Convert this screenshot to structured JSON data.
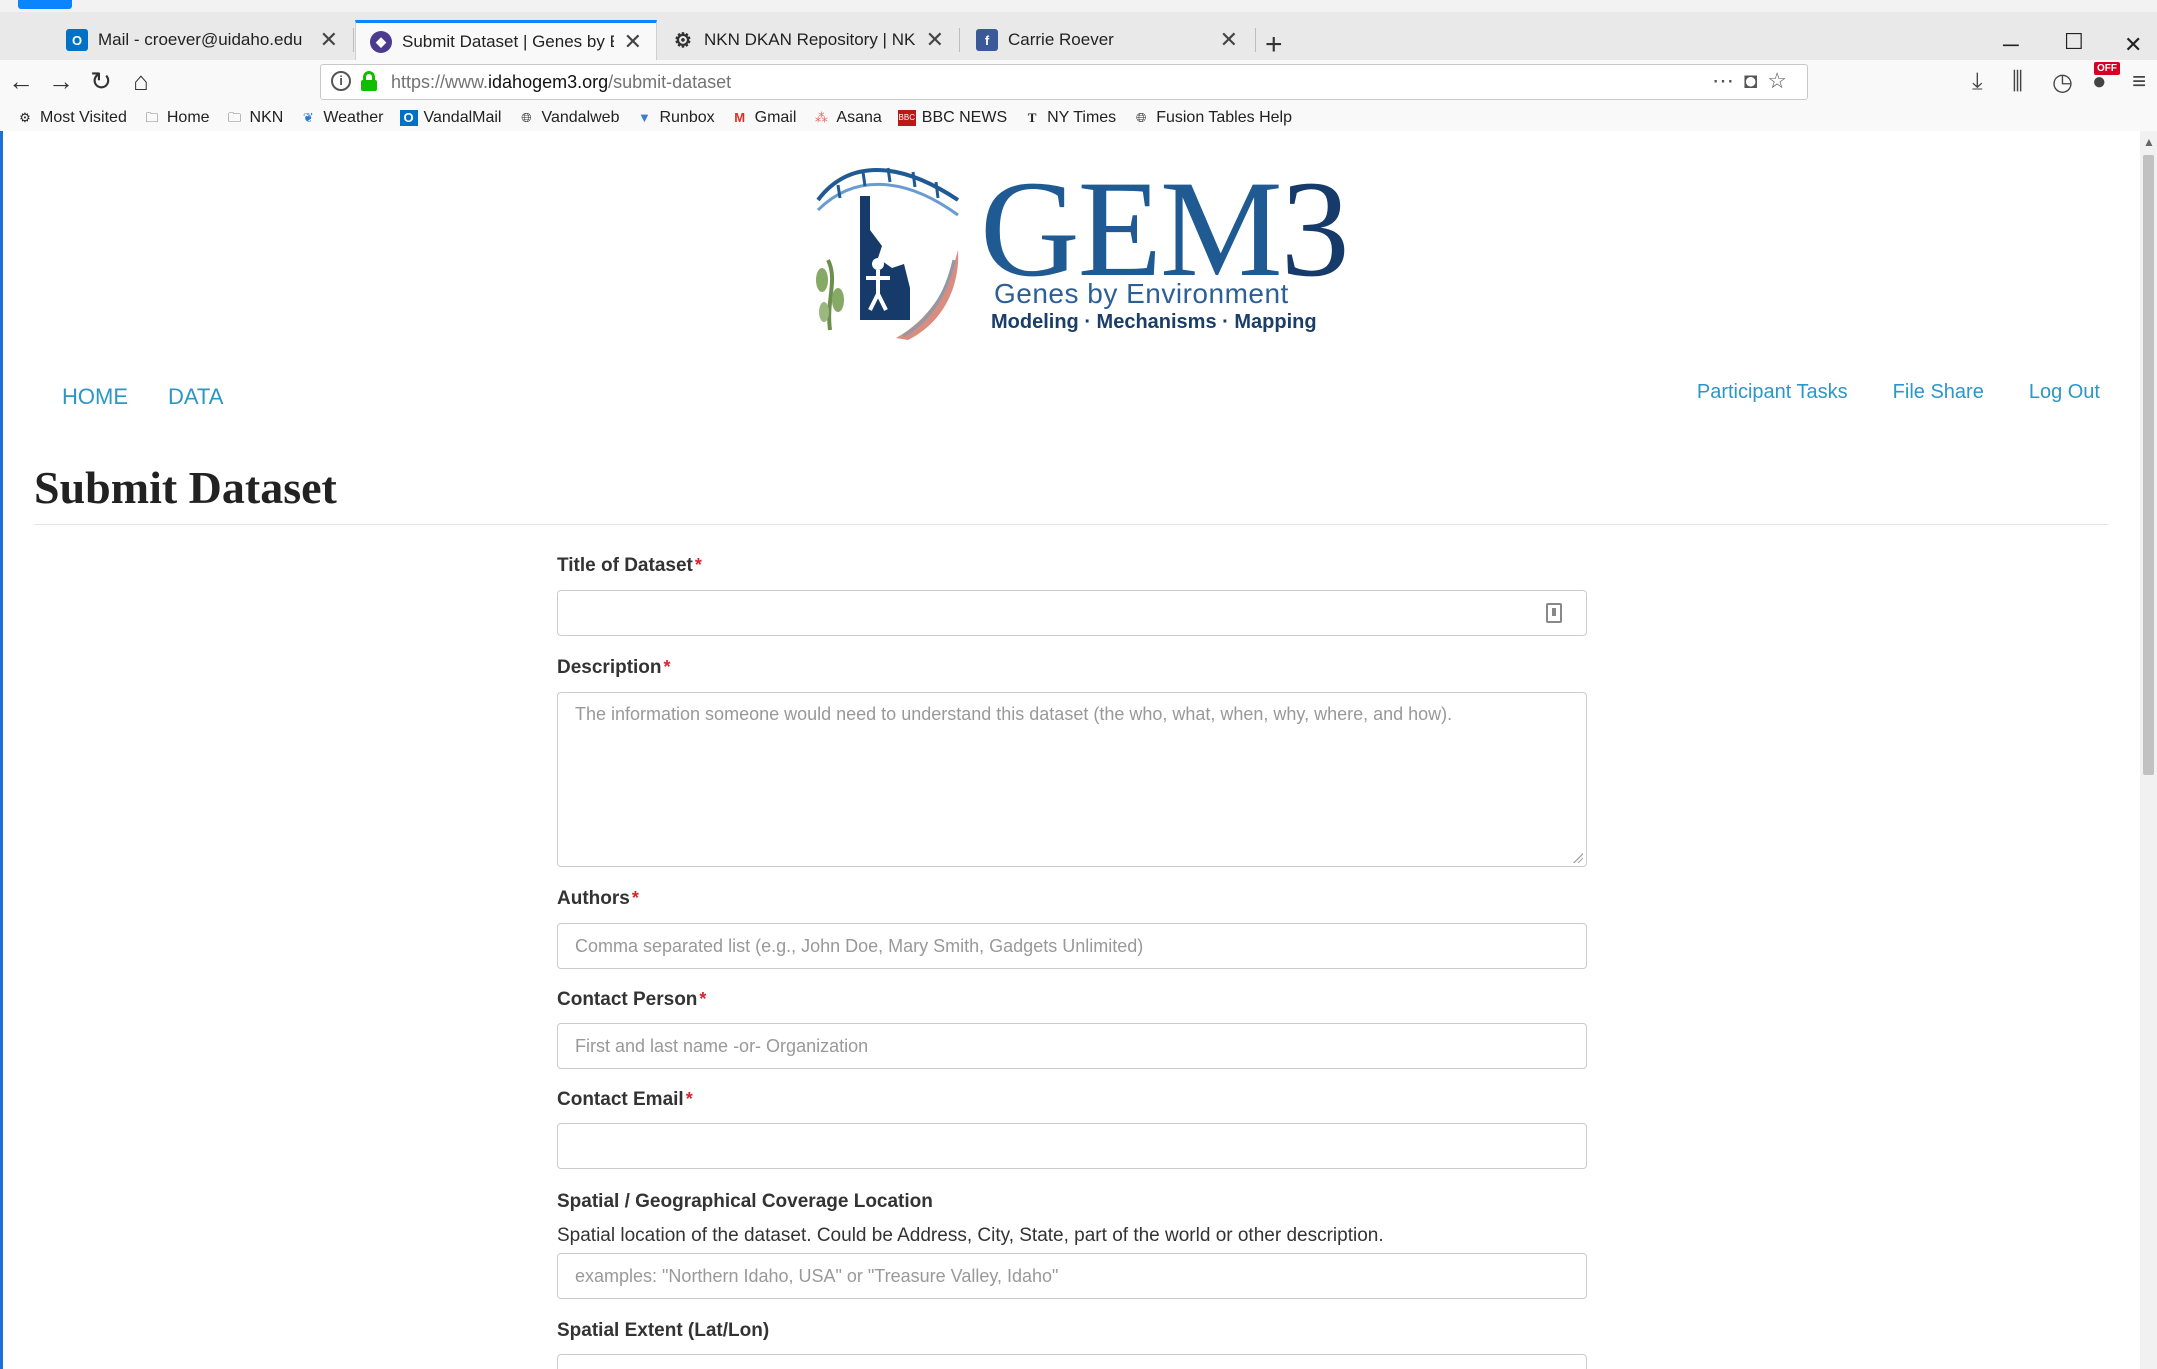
{
  "browser": {
    "tabs": [
      {
        "label": "Mail - croever@uidaho.edu",
        "icon": "outlook-icon",
        "active": false
      },
      {
        "label": "Submit Dataset | Genes by Envi",
        "icon": "gem3-icon",
        "active": true
      },
      {
        "label": "NKN DKAN Repository | NKN E",
        "icon": "dkan-icon",
        "active": false
      },
      {
        "label": "Carrie Roever",
        "icon": "facebook-icon",
        "active": false
      }
    ],
    "new_tab_symbol": "+",
    "url_prefix": "https://www.",
    "url_domain": "idahogem3.org",
    "url_path": "/submit-dataset",
    "bookmarks": [
      {
        "label": "Most Visited",
        "icon": "gear-icon"
      },
      {
        "label": "Home",
        "icon": "folder-icon"
      },
      {
        "label": "NKN",
        "icon": "folder-icon"
      },
      {
        "label": "Weather",
        "icon": "weather-icon"
      },
      {
        "label": "VandalMail",
        "icon": "outlook-icon"
      },
      {
        "label": "Vandalweb",
        "icon": "globe-icon"
      },
      {
        "label": "Runbox",
        "icon": "runbox-icon"
      },
      {
        "label": "Gmail",
        "icon": "gmail-icon"
      },
      {
        "label": "Asana",
        "icon": "asana-icon"
      },
      {
        "label": "BBC NEWS",
        "icon": "bbc-icon"
      },
      {
        "label": "NY Times",
        "icon": "nytimes-icon"
      },
      {
        "label": "Fusion Tables Help",
        "icon": "globe-icon"
      }
    ],
    "off_badge": "OFF"
  },
  "logo": {
    "title_main": "GEM",
    "title_num": "3",
    "subtitle": "Genes by Environment",
    "tagline": "Modeling · Mechanisms · Mapping"
  },
  "nav": {
    "home": "HOME",
    "data": "DATA",
    "participant_tasks": "Participant Tasks",
    "file_share": "File Share",
    "log_out": "Log Out"
  },
  "page_title": "Submit Dataset",
  "form": {
    "title_label": "Title of Dataset",
    "description_label": "Description",
    "description_placeholder": "The information someone would need to understand this dataset (the who, what, when, why, where, and how).",
    "authors_label": "Authors",
    "authors_placeholder": "Comma separated list (e.g.,  John Doe, Mary Smith, Gadgets Unlimited)",
    "contact_person_label": "Contact Person",
    "contact_person_placeholder": "First and last name -or- Organization",
    "contact_email_label": "Contact Email",
    "spatial_label": "Spatial / Geographical Coverage Location",
    "spatial_help": "Spatial location of the dataset. Could be Address, City, State, part of the world or other description.",
    "spatial_placeholder": "examples: \"Northern Idaho, USA\" or \"Treasure Valley, Idaho\"",
    "extent_label": "Spatial Extent (Lat/Lon)",
    "required_mark": "*"
  },
  "colors": {
    "link": "#2a97c7",
    "brand_blue": "#1f5a93",
    "required": "#d9232e",
    "browser_accent": "#0a84ff"
  }
}
